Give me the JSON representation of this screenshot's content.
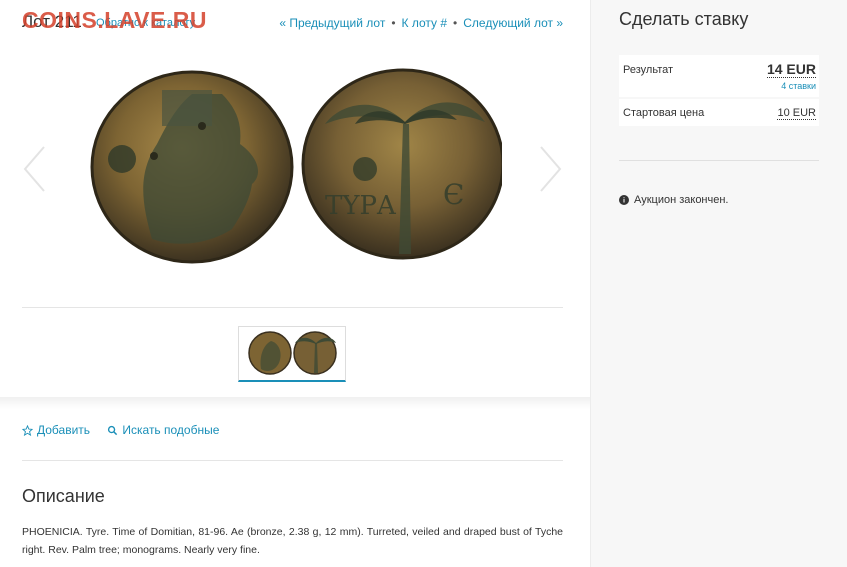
{
  "header": {
    "lot_title": "Лот 211",
    "back_link": "Обратно к каталогу",
    "watermark": "COINS.LAVE.RU",
    "prev_lot": "« Предыдущий лот",
    "goto_lot": "К лоту #",
    "next_lot": "Следующий лот »"
  },
  "actions": {
    "add": "Добавить",
    "search_similar": "Искать подобные"
  },
  "description": {
    "title": "Описание",
    "text": "PHOENICIA. Tyre. Time of Domitian, 81-96. Ae (bronze, 2.38 g, 12 mm). Turreted, veiled and draped bust of Tyche right. Rev. Palm tree; monograms. Nearly very fine."
  },
  "bid_panel": {
    "title": "Сделать ставку",
    "result_label": "Результат",
    "result_value": "14 EUR",
    "bids_count": "4 ставки",
    "start_label": "Стартовая цена",
    "start_value": "10 EUR",
    "status": "Аукцион закончен."
  },
  "colors": {
    "link": "#1a8fb8",
    "watermark": "#d4402a",
    "text": "#333333",
    "panel_bg": "#f7f7f7"
  },
  "icons": {
    "add": "star-outline-icon",
    "search": "magnifier-icon",
    "status": "info-circle-icon",
    "prev": "chevron-left-icon",
    "next": "chevron-right-icon"
  }
}
